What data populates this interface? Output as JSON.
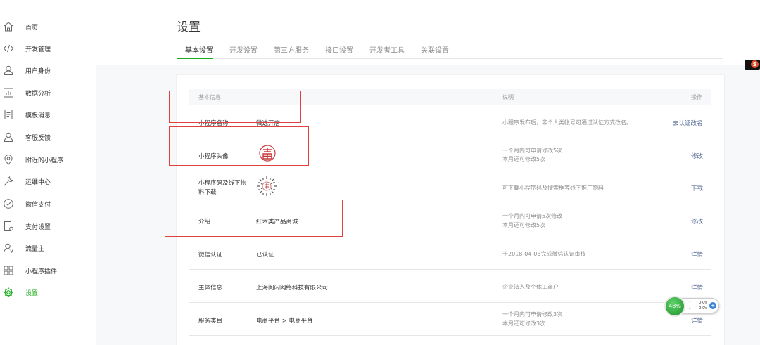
{
  "sidebar": {
    "items": [
      {
        "label": "首页",
        "icon": "home-icon"
      },
      {
        "label": "开发管理",
        "icon": "code-icon"
      },
      {
        "label": "用户身份",
        "icon": "user-icon"
      },
      {
        "label": "数据分析",
        "icon": "chart-icon"
      },
      {
        "label": "模板消息",
        "icon": "document-icon"
      },
      {
        "label": "客服反馈",
        "icon": "support-user-icon"
      },
      {
        "label": "附近的小程序",
        "icon": "location-icon"
      },
      {
        "label": "运维中心",
        "icon": "wrench-icon"
      },
      {
        "label": "微信支付",
        "icon": "wechat-pay-icon"
      },
      {
        "label": "支付设置",
        "icon": "payment-settings-icon"
      },
      {
        "label": "流量主",
        "icon": "traffic-owner-icon"
      },
      {
        "label": "小程序插件",
        "icon": "plugin-icon"
      },
      {
        "label": "设置",
        "icon": "gear-icon",
        "active": true
      }
    ]
  },
  "page": {
    "title": "设置"
  },
  "tabs": [
    {
      "label": "基本设置",
      "active": true
    },
    {
      "label": "开发设置"
    },
    {
      "label": "第三方服务"
    },
    {
      "label": "接口设置"
    },
    {
      "label": "开发者工具"
    },
    {
      "label": "关联设置"
    }
  ],
  "table": {
    "headers": {
      "info": "基本信息",
      "desc": "说明",
      "action": "操作"
    },
    "rows": [
      {
        "name": "小程序名称",
        "value": "微选开店",
        "note1": "小程序发布后，非个人类帐号可通过认证方式改名。",
        "note2": "",
        "action": "去认证改名"
      },
      {
        "name": "小程序头像",
        "value": "",
        "note1": "一个月内可申请修改5次",
        "note2": "本月还可修改5次",
        "action": "修改"
      },
      {
        "name": "小程序码及线下物料下载",
        "value": "",
        "note1": "可下载小程序码及搜索框等线下推广物料",
        "note2": "",
        "action": "下载"
      },
      {
        "name": "介绍",
        "value": "红木类产品商城",
        "note1": "一个月内可申请5次修改",
        "note2": "本月还可修改5次",
        "action": "修改"
      },
      {
        "name": "微信认证",
        "value": "已认证",
        "note1": "于2018-04-03完成微信认证审核",
        "note2": "",
        "action": "详情"
      },
      {
        "name": "主体信息",
        "value": "上海阅闲网络科技有限公司",
        "note1": "企业法人及个体工商户",
        "note2": "",
        "action": "详情"
      },
      {
        "name": "服务类目",
        "value": "电商平台 > 电商平台",
        "note1": "一个月内可申请修改3次",
        "note2": "本月还可修改3次",
        "action": "详情"
      }
    ]
  },
  "widget": {
    "percent": "48%",
    "up": "0K/s",
    "down": "0K/s",
    "plus": "+"
  },
  "side_badge": "S",
  "colors": {
    "accent": "#1aad19",
    "link": "#576b95",
    "highlight_box": "#e04040"
  }
}
